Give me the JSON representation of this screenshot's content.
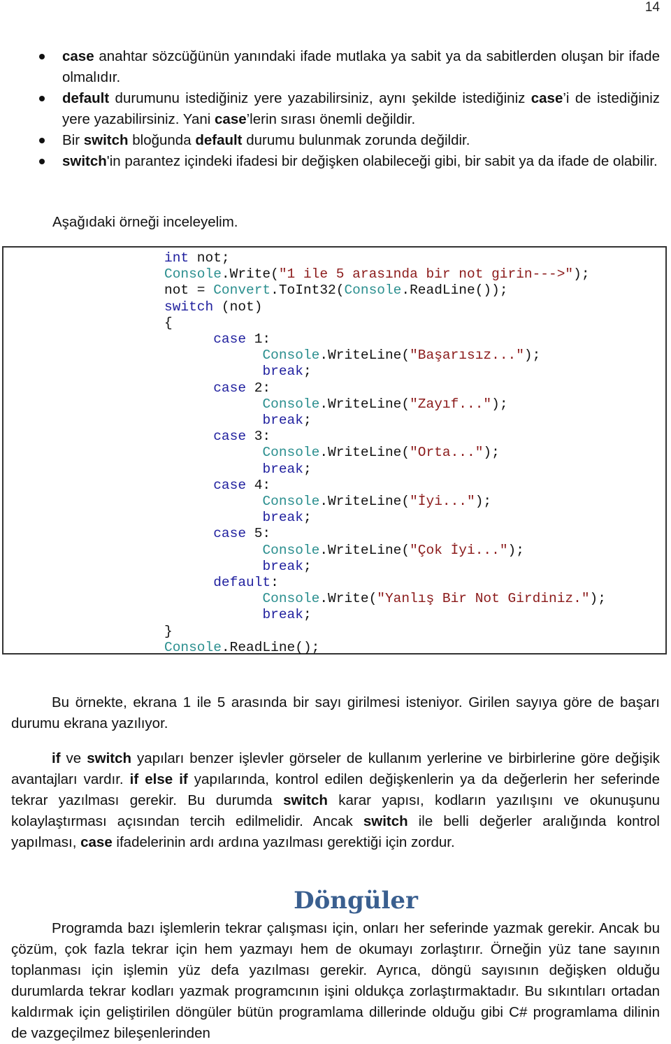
{
  "page_number": "14",
  "bullets": [
    {
      "parts": [
        {
          "b": "case"
        },
        {
          "t": " anahtar sözcüğünün yanındaki ifade mutlaka ya sabit ya da sabitlerden oluşan bir ifade olmalıdır."
        }
      ]
    },
    {
      "parts": [
        {
          "b": "default"
        },
        {
          "t": " durumunu istediğiniz yere yazabilirsiniz, aynı şekilde istediğiniz "
        },
        {
          "b": "case"
        },
        {
          "t": "’i de istediğiniz yere yazabilirsiniz. Yani "
        },
        {
          "b": "case"
        },
        {
          "t": "’lerin sırası önemli değildir."
        }
      ]
    },
    {
      "parts": [
        {
          "t": "Bir "
        },
        {
          "b": "switch"
        },
        {
          "t": " bloğunda "
        },
        {
          "b": "default"
        },
        {
          "t": " durumu bulunmak zorunda değildir."
        }
      ]
    },
    {
      "parts": [
        {
          "b": "switch"
        },
        {
          "t": "'in parantez içindeki ifadesi bir değişken olabileceği gibi, bir sabit ya da ifade de olabilir."
        }
      ]
    }
  ],
  "intro": "Aşağıdaki örneği inceleyelim.",
  "code_lines": [
    [
      {
        "c": "kw",
        "t": "int"
      },
      {
        "c": "",
        "t": " not;"
      }
    ],
    [
      {
        "c": "type",
        "t": "Console"
      },
      {
        "c": "",
        "t": ".Write("
      },
      {
        "c": "str",
        "t": "\"1 ile 5 arasında bir not girin--->\""
      },
      {
        "c": "",
        "t": ");"
      }
    ],
    [
      {
        "c": "",
        "t": "not = "
      },
      {
        "c": "type",
        "t": "Convert"
      },
      {
        "c": "",
        "t": ".ToInt32("
      },
      {
        "c": "type",
        "t": "Console"
      },
      {
        "c": "",
        "t": ".ReadLine());"
      }
    ],
    [
      {
        "c": "kw",
        "t": "switch"
      },
      {
        "c": "",
        "t": " (not)"
      }
    ],
    [
      {
        "c": "",
        "t": "{"
      }
    ],
    [
      {
        "c": "",
        "t": "      "
      },
      {
        "c": "kw",
        "t": "case"
      },
      {
        "c": "",
        "t": " 1:"
      }
    ],
    [
      {
        "c": "",
        "t": "            "
      },
      {
        "c": "type",
        "t": "Console"
      },
      {
        "c": "",
        "t": ".WriteLine("
      },
      {
        "c": "str",
        "t": "\"Başarısız...\""
      },
      {
        "c": "",
        "t": ");"
      }
    ],
    [
      {
        "c": "",
        "t": "            "
      },
      {
        "c": "kw",
        "t": "break"
      },
      {
        "c": "",
        "t": ";"
      }
    ],
    [
      {
        "c": "",
        "t": "      "
      },
      {
        "c": "kw",
        "t": "case"
      },
      {
        "c": "",
        "t": " 2:"
      }
    ],
    [
      {
        "c": "",
        "t": "            "
      },
      {
        "c": "type",
        "t": "Console"
      },
      {
        "c": "",
        "t": ".WriteLine("
      },
      {
        "c": "str",
        "t": "\"Zayıf...\""
      },
      {
        "c": "",
        "t": ");"
      }
    ],
    [
      {
        "c": "",
        "t": "            "
      },
      {
        "c": "kw",
        "t": "break"
      },
      {
        "c": "",
        "t": ";"
      }
    ],
    [
      {
        "c": "",
        "t": "      "
      },
      {
        "c": "kw",
        "t": "case"
      },
      {
        "c": "",
        "t": " 3:"
      }
    ],
    [
      {
        "c": "",
        "t": "            "
      },
      {
        "c": "type",
        "t": "Console"
      },
      {
        "c": "",
        "t": ".WriteLine("
      },
      {
        "c": "str",
        "t": "\"Orta...\""
      },
      {
        "c": "",
        "t": ");"
      }
    ],
    [
      {
        "c": "",
        "t": "            "
      },
      {
        "c": "kw",
        "t": "break"
      },
      {
        "c": "",
        "t": ";"
      }
    ],
    [
      {
        "c": "",
        "t": "      "
      },
      {
        "c": "kw",
        "t": "case"
      },
      {
        "c": "",
        "t": " 4:"
      }
    ],
    [
      {
        "c": "",
        "t": "            "
      },
      {
        "c": "type",
        "t": "Console"
      },
      {
        "c": "",
        "t": ".WriteLine("
      },
      {
        "c": "str",
        "t": "\"İyi...\""
      },
      {
        "c": "",
        "t": ");"
      }
    ],
    [
      {
        "c": "",
        "t": "            "
      },
      {
        "c": "kw",
        "t": "break"
      },
      {
        "c": "",
        "t": ";"
      }
    ],
    [
      {
        "c": "",
        "t": "      "
      },
      {
        "c": "kw",
        "t": "case"
      },
      {
        "c": "",
        "t": " 5:"
      }
    ],
    [
      {
        "c": "",
        "t": "            "
      },
      {
        "c": "type",
        "t": "Console"
      },
      {
        "c": "",
        "t": ".WriteLine("
      },
      {
        "c": "str",
        "t": "\"Çok İyi...\""
      },
      {
        "c": "",
        "t": ");"
      }
    ],
    [
      {
        "c": "",
        "t": "            "
      },
      {
        "c": "kw",
        "t": "break"
      },
      {
        "c": "",
        "t": ";"
      }
    ],
    [
      {
        "c": "",
        "t": "      "
      },
      {
        "c": "kw",
        "t": "default"
      },
      {
        "c": "",
        "t": ":"
      }
    ],
    [
      {
        "c": "",
        "t": "            "
      },
      {
        "c": "type",
        "t": "Console"
      },
      {
        "c": "",
        "t": ".Write("
      },
      {
        "c": "str",
        "t": "\"Yanlış Bir Not Girdiniz.\""
      },
      {
        "c": "",
        "t": ");"
      }
    ],
    [
      {
        "c": "",
        "t": "            "
      },
      {
        "c": "kw",
        "t": "break"
      },
      {
        "c": "",
        "t": ";"
      }
    ],
    [
      {
        "c": "",
        "t": "}"
      }
    ],
    [
      {
        "c": "type",
        "t": "Console"
      },
      {
        "c": "",
        "t": ".ReadLine();"
      }
    ]
  ],
  "paragraph_1": [
    {
      "t": "Bu örnekte, ekrana 1 ile 5 arasında bir sayı girilmesi isteniyor. Girilen sayıya göre de başarı durumu ekrana yazılıyor."
    }
  ],
  "paragraph_2": [
    {
      "b": "if"
    },
    {
      "t": " ve "
    },
    {
      "b": "switch"
    },
    {
      "t": " yapıları benzer işlevler görseler de kullanım yerlerine ve birbirlerine göre değişik avantajları vardır. "
    },
    {
      "b": "if else if"
    },
    {
      "t": " yapılarında, kontrol edilen değişkenlerin ya da değerlerin her seferinde tekrar yazılması gerekir.  Bu durumda "
    },
    {
      "b": "switch"
    },
    {
      "t": " karar yapısı, kodların yazılışını ve okunuşunu kolaylaştırması açısından tercih edilmelidir. Ancak "
    },
    {
      "b": "switch"
    },
    {
      "t": " ile belli değerler aralığında kontrol yapılması, "
    },
    {
      "b": "case"
    },
    {
      "t": " ifadelerinin ardı ardına yazılması gerektiği için zordur."
    }
  ],
  "heading": "Döngüler",
  "paragraph_3": [
    {
      "t": "Programda bazı işlemlerin tekrar çalışması için, onları her seferinde yazmak gerekir. Ancak bu çözüm, çok fazla tekrar için hem yazmayı hem de okumayı zorlaştırır. Örneğin yüz tane sayının toplanması için işlemin yüz defa yazılması gerekir. Ayrıca, döngü sayısının değişken olduğu durumlarda tekrar kodları yazmak programcının işini oldukça zorlaştırmaktadır. Bu sıkıntıları ortadan kaldırmak için geliştirilen döngüler bütün programlama dillerinde olduğu gibi C# programlama dilinin de vazgeçilmez bileşenlerinden"
    }
  ],
  "colors": {
    "keyword": "#1f1f9e",
    "type": "#2b8f8f",
    "string": "#8b1a1a",
    "heading": "#3a5f8f"
  }
}
